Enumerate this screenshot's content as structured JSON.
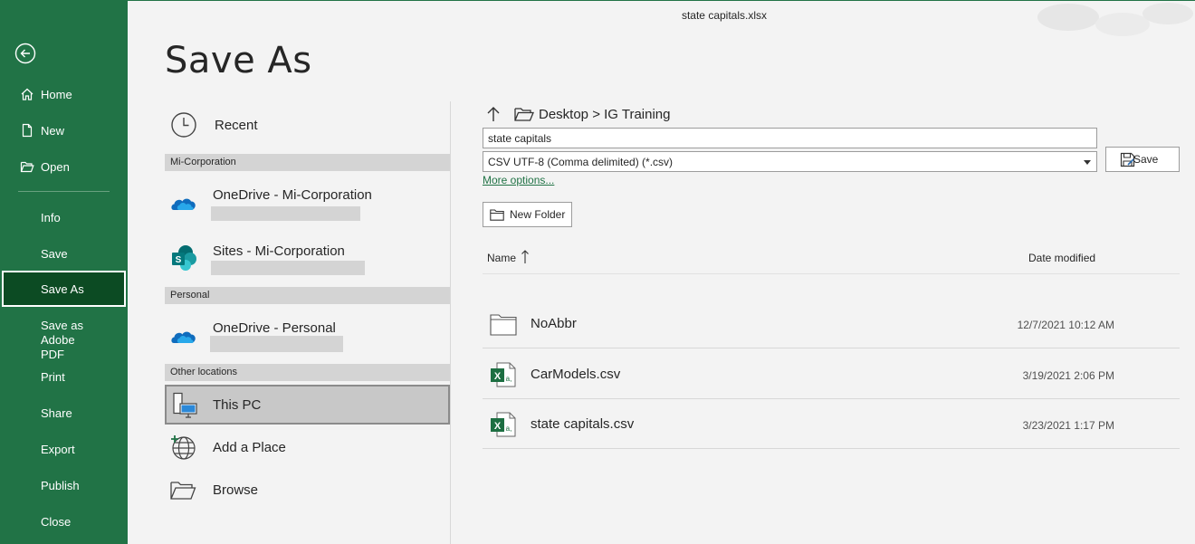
{
  "window": {
    "title": "state capitals.xlsx"
  },
  "colors": {
    "sidebar": "#217346",
    "sidebar_active": "#0c4b23",
    "link": "#217346"
  },
  "sidebar": {
    "items": [
      {
        "label": "Home",
        "icon": "home-icon"
      },
      {
        "label": "New",
        "icon": "new-document-icon"
      },
      {
        "label": "Open",
        "icon": "open-folder-icon"
      },
      {
        "label": "Info"
      },
      {
        "label": "Save"
      },
      {
        "label": "Save As",
        "active": true
      },
      {
        "label": "Save as Adobe PDF"
      },
      {
        "label": "Print"
      },
      {
        "label": "Share"
      },
      {
        "label": "Export"
      },
      {
        "label": "Publish"
      },
      {
        "label": "Close"
      }
    ]
  },
  "page": {
    "title": "Save As"
  },
  "locations": {
    "recent": "Recent",
    "groups": {
      "corporation": "Mi-Corporation",
      "personal": "Personal",
      "other": "Other locations"
    },
    "onedrive_corp": "OneDrive - Mi-Corporation",
    "sites_corp": "Sites - Mi-Corporation",
    "onedrive_personal": "OneDrive - Personal",
    "this_pc": "This PC",
    "add_place": "Add a Place",
    "browse": "Browse"
  },
  "save_pane": {
    "breadcrumb": "Desktop > IG Training",
    "filename_value": "state capitals",
    "filetype_value": "CSV UTF-8 (Comma delimited) (*.csv)",
    "save_label": "Save",
    "more_options": "More options...",
    "new_folder": "New Folder",
    "col_name": "Name",
    "col_date": "Date modified",
    "files": [
      {
        "name": "NoAbbr",
        "date": "12/7/2021 10:12 AM",
        "type": "folder"
      },
      {
        "name": "CarModels.csv",
        "date": "3/19/2021 2:06 PM",
        "type": "excel-csv"
      },
      {
        "name": "state capitals.csv",
        "date": "3/23/2021 1:17 PM",
        "type": "excel-csv"
      }
    ]
  }
}
